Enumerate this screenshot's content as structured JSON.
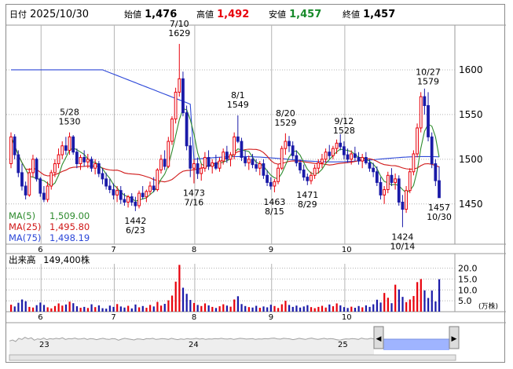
{
  "header": {
    "date_label": "日付",
    "date": "2025/10/30",
    "open_label": "始値",
    "open": "1,476",
    "high_label": "高値",
    "high": "1,492",
    "low_label": "安値",
    "low": "1,457",
    "close_label": "終値",
    "close": "1,457"
  },
  "colors": {
    "up": "#e8000b",
    "down": "#1a1aa8",
    "ma5": "#2e8b2e",
    "ma25": "#d01818",
    "ma75": "#2c47d8",
    "high_text": "#e8000b",
    "low_text": "#178a2a",
    "grid": "#b4b4b4",
    "overview_line": "#a0a0a0",
    "overview_highlight": "#9fb4ff"
  },
  "moving_averages": [
    {
      "label": "MA(5)",
      "value": "1,509.00"
    },
    {
      "label": "MA(25)",
      "value": "1,495.80"
    },
    {
      "label": "MA(75)",
      "value": "1,498.19"
    }
  ],
  "volume": {
    "label": "出来高",
    "value": "149,400株",
    "unit": "(万株)",
    "ticks": [
      "20.0",
      "15.0",
      "10.0",
      "5.0"
    ]
  },
  "overview": {
    "year_labels": [
      "23",
      "24",
      "25"
    ],
    "left_arrow": "◀",
    "right_arrow": "▶"
  },
  "chart_data": {
    "type": "candlestick",
    "x_month_labels": [
      "6",
      "7",
      "8",
      "9",
      "10"
    ],
    "price_ticks": [
      1450,
      1500,
      1550,
      1600
    ],
    "price_range": [
      1405,
      1650
    ],
    "volume_range": [
      0,
      22
    ],
    "annotations": [
      {
        "text": [
          "5/28",
          "1530"
        ],
        "index": 16,
        "position": "above"
      },
      {
        "text": [
          "7/10",
          "1629"
        ],
        "index": 46,
        "position": "above"
      },
      {
        "text": [
          "8/1",
          "1549"
        ],
        "index": 62,
        "position": "above"
      },
      {
        "text": [
          "8/20",
          "1529"
        ],
        "index": 75,
        "position": "above"
      },
      {
        "text": [
          "9/12",
          "1528"
        ],
        "index": 91,
        "position": "above"
      },
      {
        "text": [
          "10/27",
          "1579"
        ],
        "index": 114,
        "position": "above"
      },
      {
        "text": [
          "1442",
          "6/23"
        ],
        "index": 34,
        "position": "below"
      },
      {
        "text": [
          "1473",
          "7/16"
        ],
        "index": 50,
        "position": "below"
      },
      {
        "text": [
          "1463",
          "8/15"
        ],
        "index": 72,
        "position": "below"
      },
      {
        "text": [
          "1471",
          "8/29"
        ],
        "index": 81,
        "position": "below"
      },
      {
        "text": [
          "1424",
          "10/14"
        ],
        "index": 107,
        "position": "below"
      },
      {
        "text": [
          "1457",
          "10/30"
        ],
        "index": 117,
        "position": "below"
      }
    ],
    "candles": [
      [
        1495,
        1530,
        1490,
        1525
      ],
      [
        1525,
        1528,
        1500,
        1505
      ],
      [
        1505,
        1510,
        1480,
        1485
      ],
      [
        1485,
        1495,
        1465,
        1470
      ],
      [
        1470,
        1475,
        1455,
        1460
      ],
      [
        1460,
        1490,
        1458,
        1485
      ],
      [
        1485,
        1505,
        1480,
        1500
      ],
      [
        1500,
        1502,
        1475,
        1478
      ],
      [
        1478,
        1480,
        1458,
        1462
      ],
      [
        1462,
        1470,
        1452,
        1455
      ],
      [
        1455,
        1475,
        1452,
        1470
      ],
      [
        1470,
        1488,
        1466,
        1485
      ],
      [
        1485,
        1500,
        1480,
        1495
      ],
      [
        1495,
        1512,
        1490,
        1505
      ],
      [
        1505,
        1520,
        1500,
        1515
      ],
      [
        1515,
        1525,
        1505,
        1510
      ],
      [
        1510,
        1530,
        1505,
        1525
      ],
      [
        1525,
        1527,
        1505,
        1508
      ],
      [
        1508,
        1512,
        1490,
        1495
      ],
      [
        1495,
        1505,
        1488,
        1502
      ],
      [
        1502,
        1510,
        1492,
        1497
      ],
      [
        1497,
        1506,
        1490,
        1500
      ],
      [
        1500,
        1503,
        1486,
        1490
      ],
      [
        1490,
        1500,
        1483,
        1495
      ],
      [
        1495,
        1498,
        1480,
        1484
      ],
      [
        1484,
        1490,
        1472,
        1478
      ],
      [
        1478,
        1485,
        1466,
        1470
      ],
      [
        1470,
        1478,
        1462,
        1466
      ],
      [
        1466,
        1473,
        1455,
        1460
      ],
      [
        1460,
        1470,
        1452,
        1465
      ],
      [
        1465,
        1470,
        1450,
        1455
      ],
      [
        1455,
        1462,
        1448,
        1452
      ],
      [
        1452,
        1460,
        1446,
        1458
      ],
      [
        1458,
        1462,
        1448,
        1452
      ],
      [
        1452,
        1458,
        1442,
        1448
      ],
      [
        1448,
        1465,
        1445,
        1462
      ],
      [
        1462,
        1470,
        1455,
        1458
      ],
      [
        1458,
        1466,
        1452,
        1464
      ],
      [
        1464,
        1475,
        1460,
        1470
      ],
      [
        1470,
        1480,
        1463,
        1466
      ],
      [
        1466,
        1490,
        1464,
        1488
      ],
      [
        1488,
        1505,
        1484,
        1500
      ],
      [
        1500,
        1510,
        1488,
        1492
      ],
      [
        1492,
        1525,
        1490,
        1520
      ],
      [
        1520,
        1548,
        1516,
        1545
      ],
      [
        1545,
        1580,
        1540,
        1575
      ],
      [
        1575,
        1629,
        1570,
        1590
      ],
      [
        1590,
        1598,
        1548,
        1552
      ],
      [
        1552,
        1560,
        1510,
        1515
      ],
      [
        1515,
        1525,
        1480,
        1490
      ],
      [
        1490,
        1500,
        1473,
        1495
      ],
      [
        1495,
        1502,
        1478,
        1484
      ],
      [
        1484,
        1495,
        1476,
        1490
      ],
      [
        1490,
        1508,
        1486,
        1502
      ],
      [
        1502,
        1510,
        1488,
        1492
      ],
      [
        1492,
        1500,
        1484,
        1496
      ],
      [
        1496,
        1505,
        1488,
        1490
      ],
      [
        1490,
        1502,
        1486,
        1498
      ],
      [
        1498,
        1512,
        1494,
        1508
      ],
      [
        1508,
        1515,
        1496,
        1500
      ],
      [
        1500,
        1508,
        1492,
        1505
      ],
      [
        1505,
        1530,
        1500,
        1525
      ],
      [
        1525,
        1549,
        1518,
        1520
      ],
      [
        1520,
        1524,
        1498,
        1502
      ],
      [
        1502,
        1510,
        1492,
        1496
      ],
      [
        1496,
        1504,
        1488,
        1500
      ],
      [
        1500,
        1506,
        1490,
        1494
      ],
      [
        1494,
        1500,
        1486,
        1490
      ],
      [
        1490,
        1498,
        1482,
        1495
      ],
      [
        1495,
        1500,
        1478,
        1482
      ],
      [
        1482,
        1488,
        1470,
        1474
      ],
      [
        1474,
        1480,
        1466,
        1470
      ],
      [
        1470,
        1478,
        1463,
        1475
      ],
      [
        1475,
        1495,
        1472,
        1490
      ],
      [
        1490,
        1515,
        1488,
        1512
      ],
      [
        1512,
        1529,
        1505,
        1520
      ],
      [
        1520,
        1526,
        1508,
        1515
      ],
      [
        1515,
        1520,
        1500,
        1504
      ],
      [
        1504,
        1510,
        1492,
        1496
      ],
      [
        1496,
        1500,
        1484,
        1488
      ],
      [
        1488,
        1494,
        1476,
        1480
      ],
      [
        1480,
        1484,
        1471,
        1476
      ],
      [
        1476,
        1486,
        1472,
        1482
      ],
      [
        1482,
        1494,
        1478,
        1490
      ],
      [
        1490,
        1500,
        1484,
        1496
      ],
      [
        1496,
        1506,
        1490,
        1500
      ],
      [
        1500,
        1512,
        1496,
        1508
      ],
      [
        1508,
        1516,
        1500,
        1504
      ],
      [
        1504,
        1515,
        1500,
        1512
      ],
      [
        1512,
        1522,
        1506,
        1518
      ],
      [
        1518,
        1528,
        1510,
        1514
      ],
      [
        1514,
        1520,
        1500,
        1505
      ],
      [
        1505,
        1512,
        1496,
        1500
      ],
      [
        1500,
        1510,
        1494,
        1506
      ],
      [
        1506,
        1514,
        1498,
        1502
      ],
      [
        1502,
        1508,
        1494,
        1498
      ],
      [
        1498,
        1506,
        1490,
        1502
      ],
      [
        1502,
        1508,
        1494,
        1496
      ],
      [
        1496,
        1500,
        1486,
        1490
      ],
      [
        1490,
        1496,
        1480,
        1486
      ],
      [
        1486,
        1492,
        1470,
        1474
      ],
      [
        1474,
        1480,
        1455,
        1460
      ],
      [
        1460,
        1470,
        1450,
        1466
      ],
      [
        1466,
        1486,
        1462,
        1482
      ],
      [
        1482,
        1490,
        1470,
        1474
      ],
      [
        1474,
        1484,
        1466,
        1478
      ],
      [
        1478,
        1482,
        1448,
        1452
      ],
      [
        1452,
        1460,
        1424,
        1444
      ],
      [
        1444,
        1470,
        1440,
        1465
      ],
      [
        1465,
        1490,
        1462,
        1486
      ],
      [
        1486,
        1510,
        1482,
        1506
      ],
      [
        1506,
        1540,
        1502,
        1535
      ],
      [
        1535,
        1575,
        1530,
        1570
      ],
      [
        1570,
        1579,
        1550,
        1560
      ],
      [
        1560,
        1575,
        1520,
        1525
      ],
      [
        1525,
        1530,
        1490,
        1495
      ],
      [
        1495,
        1500,
        1470,
        1476
      ],
      [
        1476,
        1492,
        1457,
        1457
      ]
    ],
    "volumes": [
      3.2,
      2.4,
      4.1,
      5.6,
      4.8,
      2.2,
      1.9,
      3.0,
      4.2,
      3.1,
      2.0,
      1.5,
      2.6,
      3.8,
      2.8,
      3.3,
      4.6,
      3.9,
      2.5,
      1.8,
      2.2,
      1.7,
      3.4,
      2.1,
      2.9,
      1.6,
      1.4,
      2.8,
      2.2,
      3.5,
      2.4,
      1.9,
      2.7,
      1.5,
      3.3,
      2.0,
      2.6,
      1.8,
      3.1,
      2.4,
      4.5,
      2.8,
      3.6,
      5.2,
      7.4,
      13.8,
      21.5,
      11.0,
      8.2,
      5.4,
      4.0,
      3.1,
      2.6,
      3.8,
      2.9,
      2.2,
      1.7,
      2.5,
      3.4,
      2.8,
      2.3,
      5.6,
      7.1,
      3.5,
      2.6,
      2.1,
      1.9,
      2.7,
      1.8,
      2.4,
      2.0,
      3.2,
      2.6,
      1.7,
      3.4,
      5.0,
      3.1,
      2.2,
      2.8,
      1.9,
      2.4,
      3.0,
      2.1,
      1.6,
      2.2,
      2.7,
      1.9,
      3.3,
      2.5,
      3.8,
      2.9,
      2.1,
      1.7,
      2.3,
      1.8,
      2.6,
      2.0,
      2.9,
      2.2,
      3.4,
      5.5,
      4.2,
      8.6,
      6.4,
      3.9,
      12.4,
      10.2,
      6.8,
      4.4,
      5.6,
      7.2,
      13.6,
      15.0,
      9.8,
      6.3,
      9.7,
      4.7,
      14.9
    ],
    "overview_series": [
      0.52,
      0.56,
      0.5,
      0.62,
      0.58,
      0.66,
      0.6,
      0.64,
      0.55,
      0.6,
      0.58,
      0.63,
      0.57,
      0.61,
      0.59,
      0.62,
      0.6,
      0.64,
      0.58,
      0.61,
      0.6,
      0.63,
      0.59,
      0.6,
      0.62,
      0.58,
      0.61,
      0.6,
      0.57,
      0.6,
      0.62,
      0.59,
      0.58,
      0.61,
      0.6,
      0.55,
      0.59,
      0.62,
      0.6,
      0.58,
      0.56,
      0.6,
      0.59,
      0.57,
      0.61,
      0.6,
      0.62,
      0.58,
      0.59,
      0.61,
      0.6,
      0.58,
      0.62,
      0.59,
      0.57,
      0.6,
      0.58,
      0.61,
      0.59,
      0.6,
      0.62,
      0.59,
      0.61,
      0.58,
      0.6,
      0.59,
      0.61,
      0.6,
      0.62,
      0.6,
      0.59,
      0.61,
      0.58,
      0.6,
      0.62,
      0.61,
      0.59,
      0.6,
      0.61,
      0.58,
      0.6,
      0.59,
      0.61,
      0.6,
      0.62,
      0.63,
      0.6,
      0.59,
      0.62,
      0.61,
      0.6,
      0.57,
      0.59,
      0.62,
      0.6,
      0.58,
      0.61,
      0.63,
      0.6,
      0.58,
      0.6,
      0.62,
      0.59,
      0.61,
      0.6,
      0.57,
      0.55,
      0.58,
      0.6,
      0.59,
      0.61,
      0.6,
      0.58,
      0.63,
      0.6,
      0.59,
      0.62,
      0.6
    ]
  }
}
